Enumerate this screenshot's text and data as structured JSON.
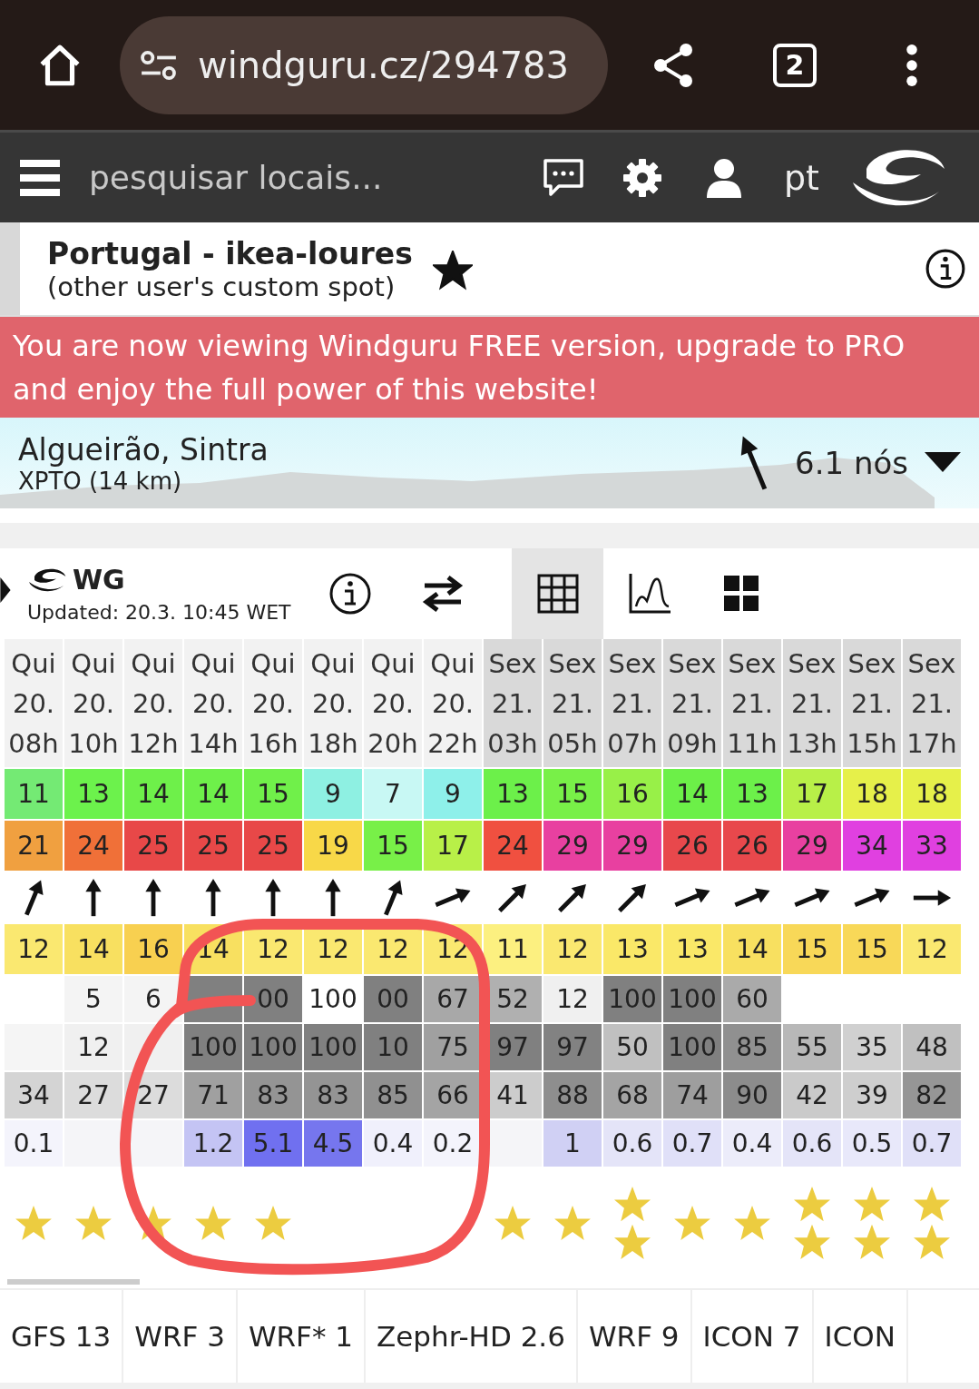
{
  "browser": {
    "url": "windguru.cz/294783",
    "tab_count": "2"
  },
  "nav": {
    "search_placeholder": "pesquisar locais...",
    "language": "pt"
  },
  "spot": {
    "title": "Portugal - ikea-loures",
    "subtitle": "(other user's custom spot)",
    "favorite": true
  },
  "banner": "You are now viewing Windguru FREE version, upgrade to PRO and enjoy the full power of this website!",
  "station": {
    "name": "Algueirão, Sintra",
    "detail": "XPTO  (14 km)",
    "wind": "6.1 nós",
    "arrow": {
      "kind": "nnw"
    }
  },
  "model": {
    "name": "WG",
    "updated": "Updated: 20.3. 10:45 WET",
    "views": [
      {
        "kind": "table",
        "selected": true
      },
      {
        "kind": "graph",
        "selected": false
      },
      {
        "kind": "tiles",
        "selected": false
      }
    ]
  },
  "forecast": {
    "columns": [
      {
        "day": "Qui",
        "date": "20.",
        "hour": "08h",
        "color": "#f2f2f2"
      },
      {
        "day": "Qui",
        "date": "20.",
        "hour": "10h",
        "color": "#f2f2f2"
      },
      {
        "day": "Qui",
        "date": "20.",
        "hour": "12h",
        "color": "#f2f2f2"
      },
      {
        "day": "Qui",
        "date": "20.",
        "hour": "14h",
        "color": "#f2f2f2"
      },
      {
        "day": "Qui",
        "date": "20.",
        "hour": "16h",
        "color": "#f2f2f2"
      },
      {
        "day": "Qui",
        "date": "20.",
        "hour": "18h",
        "color": "#f2f2f2"
      },
      {
        "day": "Qui",
        "date": "20.",
        "hour": "20h",
        "color": "#f2f2f2"
      },
      {
        "day": "Qui",
        "date": "20.",
        "hour": "22h",
        "color": "#f2f2f2"
      },
      {
        "day": "Sex",
        "date": "21.",
        "hour": "03h",
        "color": "#d9d9d9"
      },
      {
        "day": "Sex",
        "date": "21.",
        "hour": "05h",
        "color": "#d9d9d9"
      },
      {
        "day": "Sex",
        "date": "21.",
        "hour": "07h",
        "color": "#d9d9d9"
      },
      {
        "day": "Sex",
        "date": "21.",
        "hour": "09h",
        "color": "#d9d9d9"
      },
      {
        "day": "Sex",
        "date": "21.",
        "hour": "11h",
        "color": "#d9d9d9"
      },
      {
        "day": "Sex",
        "date": "21.",
        "hour": "13h",
        "color": "#d9d9d9"
      },
      {
        "day": "Sex",
        "date": "21.",
        "hour": "15h",
        "color": "#d9d9d9"
      },
      {
        "day": "Sex",
        "date": "21.",
        "hour": "17h",
        "color": "#d9d9d9"
      }
    ],
    "rows": [
      {
        "kind": "wind",
        "cells": [
          {
            "text": "11",
            "color": "#74ea74"
          },
          {
            "text": "13",
            "color": "#6cf24c"
          },
          {
            "text": "14",
            "color": "#6ef04a"
          },
          {
            "text": "14",
            "color": "#6ef04a"
          },
          {
            "text": "15",
            "color": "#70f04a"
          },
          {
            "text": "9",
            "color": "#8ef0e2"
          },
          {
            "text": "7",
            "color": "#c8f8f4"
          },
          {
            "text": "9",
            "color": "#8ef0ea"
          },
          {
            "text": "13",
            "color": "#6cf04a"
          },
          {
            "text": "15",
            "color": "#78f048"
          },
          {
            "text": "16",
            "color": "#98f048"
          },
          {
            "text": "14",
            "color": "#6cf048"
          },
          {
            "text": "13",
            "color": "#6cf04a"
          },
          {
            "text": "17",
            "color": "#b8f048"
          },
          {
            "text": "18",
            "color": "#e6f04a"
          },
          {
            "text": "18",
            "color": "#e6f04a"
          }
        ]
      },
      {
        "kind": "gust",
        "cells": [
          {
            "text": "21",
            "color": "#f0a040"
          },
          {
            "text": "24",
            "color": "#f07038"
          },
          {
            "text": "25",
            "color": "#e84848"
          },
          {
            "text": "25",
            "color": "#e84848"
          },
          {
            "text": "25",
            "color": "#e84848"
          },
          {
            "text": "19",
            "color": "#f8d848"
          },
          {
            "text": "15",
            "color": "#78f048"
          },
          {
            "text": "17",
            "color": "#b8f048"
          },
          {
            "text": "24",
            "color": "#f05040"
          },
          {
            "text": "29",
            "color": "#e840a0"
          },
          {
            "text": "29",
            "color": "#e840a0"
          },
          {
            "text": "26",
            "color": "#e8484c"
          },
          {
            "text": "26",
            "color": "#e8484c"
          },
          {
            "text": "29",
            "color": "#e840a0"
          },
          {
            "text": "34",
            "color": "#e040e0"
          },
          {
            "text": "33",
            "color": "#e040e0"
          }
        ]
      },
      {
        "kind": "direction",
        "cells": [
          {
            "kind": "nne"
          },
          {
            "kind": "n"
          },
          {
            "kind": "n"
          },
          {
            "kind": "n"
          },
          {
            "kind": "n"
          },
          {
            "kind": "n"
          },
          {
            "kind": "nne"
          },
          {
            "kind": "ene"
          },
          {
            "kind": "ne"
          },
          {
            "kind": "ne"
          },
          {
            "kind": "ne"
          },
          {
            "kind": "ene"
          },
          {
            "kind": "ene"
          },
          {
            "kind": "ene"
          },
          {
            "kind": "ene"
          },
          {
            "kind": "e"
          }
        ]
      },
      {
        "kind": "temperature",
        "cells": [
          {
            "text": "12",
            "color": "#fae870"
          },
          {
            "text": "14",
            "color": "#f8e060"
          },
          {
            "text": "16",
            "color": "#f8d050"
          },
          {
            "text": "14",
            "color": "#f8e060"
          },
          {
            "text": "12",
            "color": "#fae870"
          },
          {
            "text": "12",
            "color": "#fae870"
          },
          {
            "text": "12",
            "color": "#fae870"
          },
          {
            "text": "12",
            "color": "#fae870"
          },
          {
            "text": "11",
            "color": "#fcf080"
          },
          {
            "text": "12",
            "color": "#fae870"
          },
          {
            "text": "13",
            "color": "#fae868"
          },
          {
            "text": "13",
            "color": "#fae868"
          },
          {
            "text": "14",
            "color": "#f8e060"
          },
          {
            "text": "15",
            "color": "#f8d858"
          },
          {
            "text": "15",
            "color": "#f8d858"
          },
          {
            "text": "12",
            "color": "#fae870"
          }
        ]
      },
      {
        "kind": "cloud_high",
        "cells": [
          {},
          {
            "text": "5",
            "color": "#f4f4f4"
          },
          {
            "text": "6",
            "color": "#f4f4f4"
          },
          {
            "color": "#808080"
          },
          {
            "text": "00",
            "color": "#808080"
          },
          {
            "text": "100",
            "color": "#ffffff"
          },
          {
            "text": "00",
            "color": "#808080"
          },
          {
            "text": "67",
            "color": "#a8a8a8"
          },
          {
            "text": "52",
            "color": "#b0b0b0"
          },
          {
            "text": "12",
            "color": "#f0f0f0"
          },
          {
            "text": "100",
            "color": "#808080"
          },
          {
            "text": "100",
            "color": "#808080"
          },
          {
            "text": "60",
            "color": "#aaaaaa"
          },
          {},
          {},
          {}
        ]
      },
      {
        "kind": "cloud_mid",
        "cells": [
          {
            "color": "#f5f5f5"
          },
          {
            "text": "12",
            "color": "#f0f0f0"
          },
          {
            "color": "#f0f0f0"
          },
          {
            "text": "100",
            "color": "#808080"
          },
          {
            "text": "100",
            "color": "#808080"
          },
          {
            "text": "100",
            "color": "#808080"
          },
          {
            "text": "10",
            "color": "#808080"
          },
          {
            "text": "75",
            "color": "#a0a0a0"
          },
          {
            "text": "97",
            "color": "#808080"
          },
          {
            "text": "97",
            "color": "#828282"
          },
          {
            "text": "50",
            "color": "#c0c0c0"
          },
          {
            "text": "100",
            "color": "#808080"
          },
          {
            "text": "85",
            "color": "#909090"
          },
          {
            "text": "55",
            "color": "#b8b8b8"
          },
          {
            "text": "35",
            "color": "#d0d0d0"
          },
          {
            "text": "48",
            "color": "#c0c0c0"
          }
        ]
      },
      {
        "kind": "cloud_low",
        "cells": [
          {
            "text": "34",
            "color": "#d4d4d4"
          },
          {
            "text": "27",
            "color": "#dcdcdc"
          },
          {
            "text": "27",
            "color": "#dcdcdc"
          },
          {
            "text": "71",
            "color": "#a0a0a0"
          },
          {
            "text": "83",
            "color": "#949494"
          },
          {
            "text": "83",
            "color": "#949494"
          },
          {
            "text": "85",
            "color": "#909090"
          },
          {
            "text": "66",
            "color": "#a4a4a4"
          },
          {
            "text": "41",
            "color": "#cccccc"
          },
          {
            "text": "88",
            "color": "#8e8e8e"
          },
          {
            "text": "68",
            "color": "#a4a4a4"
          },
          {
            "text": "74",
            "color": "#9e9e9e"
          },
          {
            "text": "90",
            "color": "#8c8c8c"
          },
          {
            "text": "42",
            "color": "#cacaca"
          },
          {
            "text": "39",
            "color": "#cecece"
          },
          {
            "text": "82",
            "color": "#969696"
          }
        ]
      },
      {
        "kind": "rain",
        "cells": [
          {
            "text": "0.1",
            "color": "#f4f4fc"
          },
          {
            "color": "#f5f5f8"
          },
          {
            "color": "#f5f5f8"
          },
          {
            "text": "1.2",
            "color": "#c4c4f4"
          },
          {
            "text": "5.1",
            "color": "#7070f0"
          },
          {
            "text": "4.5",
            "color": "#7676ee"
          },
          {
            "text": "0.4",
            "color": "#f0f0fc"
          },
          {
            "text": "0.2",
            "color": "#f4f4fc"
          },
          {
            "color": "#f5f5f8"
          },
          {
            "text": "1",
            "color": "#d0d0f4"
          },
          {
            "text": "0.6",
            "color": "#e4e4f8"
          },
          {
            "text": "0.7",
            "color": "#e0e0f8"
          },
          {
            "text": "0.4",
            "color": "#ececfa"
          },
          {
            "text": "0.6",
            "color": "#e4e4f8"
          },
          {
            "text": "0.5",
            "color": "#e8e8fa"
          },
          {
            "text": "0.7",
            "color": "#e0e0f8"
          }
        ]
      },
      {
        "kind": "rating",
        "cells": [
          {
            "kind": "single"
          },
          {
            "kind": "single"
          },
          {
            "kind": "single"
          },
          {
            "kind": "single"
          },
          {
            "kind": "single"
          },
          {},
          {},
          {},
          {
            "kind": "single"
          },
          {
            "kind": "single"
          },
          {
            "kind": "double"
          },
          {
            "kind": "single"
          },
          {
            "kind": "single"
          },
          {
            "kind": "double"
          },
          {
            "kind": "double"
          },
          {
            "kind": "double"
          }
        ]
      }
    ]
  },
  "annotation": {
    "kind": "circle",
    "color": "#f25454"
  },
  "model_tabs": [
    "GFS 13",
    "WRF 3",
    "WRF* 1",
    "Zephr-HD 2.6",
    "WRF 9",
    "ICON 7",
    "ICON"
  ]
}
